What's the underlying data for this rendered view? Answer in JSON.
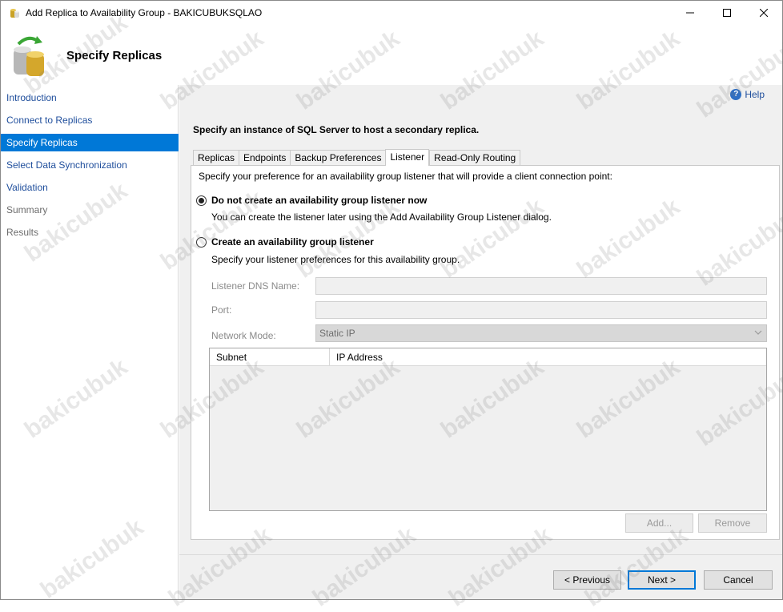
{
  "window": {
    "title": "Add Replica to Availability Group - BAKICUBUKSQLAO",
    "controls": [
      "minimize-icon",
      "maximize-icon",
      "close-icon"
    ]
  },
  "header": {
    "title": "Specify Replicas",
    "icon": "database-replica-icon"
  },
  "sidebar": {
    "items": [
      {
        "label": "Introduction",
        "state": "link"
      },
      {
        "label": "Connect to Replicas",
        "state": "link"
      },
      {
        "label": "Specify Replicas",
        "state": "active"
      },
      {
        "label": "Select Data Synchronization",
        "state": "link"
      },
      {
        "label": "Validation",
        "state": "link"
      },
      {
        "label": "Summary",
        "state": "disabled"
      },
      {
        "label": "Results",
        "state": "disabled"
      }
    ]
  },
  "main": {
    "help_label": "Help",
    "instruction": "Specify an instance of SQL Server to host a secondary replica.",
    "tabs": [
      {
        "label": "Replicas",
        "active": false
      },
      {
        "label": "Endpoints",
        "active": false
      },
      {
        "label": "Backup Preferences",
        "active": false
      },
      {
        "label": "Listener",
        "active": true
      },
      {
        "label": "Read-Only Routing",
        "active": false
      }
    ],
    "listener": {
      "description": "Specify your preference for an availability group listener that will provide a client connection point:",
      "option_none": {
        "label": "Do not create an availability group listener now",
        "sub": "You can create the listener later using the Add Availability Group Listener dialog.",
        "checked": true
      },
      "option_create": {
        "label": "Create an availability group listener",
        "sub": "Specify your listener preferences for this availability group.",
        "checked": false
      },
      "dns_label": "Listener DNS Name:",
      "dns_value": "",
      "port_label": "Port:",
      "port_value": "",
      "network_mode_label": "Network Mode:",
      "network_mode_value": "Static IP",
      "grid_columns": [
        "Subnet",
        "IP Address"
      ],
      "grid_rows": [],
      "add_label": "Add...",
      "remove_label": "Remove"
    }
  },
  "footer": {
    "previous_label": "< Previous",
    "next_label": "Next >",
    "cancel_label": "Cancel"
  },
  "watermark": "bakicubuk",
  "colors": {
    "accent": "#0078d7",
    "link": "#1f4e9c",
    "panel_bg": "#f0f0f0"
  }
}
